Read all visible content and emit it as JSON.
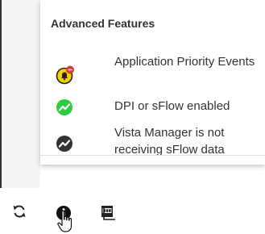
{
  "popover": {
    "title": "Advanced Features",
    "items": [
      {
        "label": "Application Priority Events",
        "icon": "alert-bell-icon",
        "color": "#f5d100"
      },
      {
        "label": "DPI or sFlow enabled",
        "icon": "trend-active-icon",
        "color": "#2ecc40"
      },
      {
        "label": "Vista Manager is not receiving sFlow data",
        "icon": "trend-inactive-icon",
        "color": "#333333"
      }
    ]
  },
  "toolbar": {
    "buttons": [
      {
        "icon": "refresh-icon"
      },
      {
        "icon": "info-icon"
      },
      {
        "icon": "pdf-export-icon"
      }
    ]
  },
  "colors": {
    "alert_badge": "#e53935",
    "text": "#333333"
  }
}
